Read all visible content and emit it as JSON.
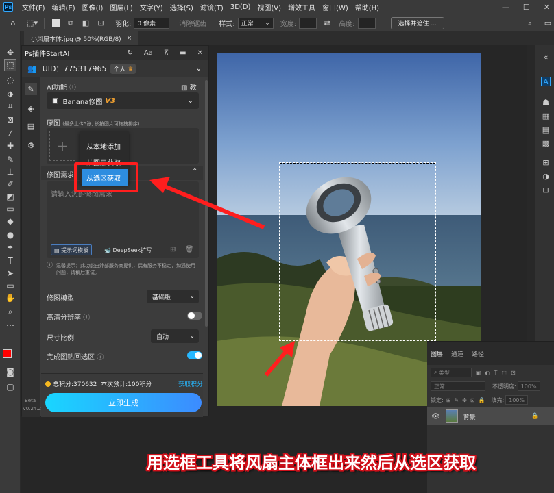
{
  "menu": [
    "文件(F)",
    "编辑(E)",
    "图像(I)",
    "图层(L)",
    "文字(Y)",
    "选择(S)",
    "滤镜(T)",
    "3D(D)",
    "视图(V)",
    "增效工具",
    "窗口(W)",
    "帮助(H)"
  ],
  "window_controls": [
    "—",
    "☐",
    "✕"
  ],
  "options": {
    "feather_label": "羽化:",
    "feather_value": "0 像素",
    "antialias_label": "消除锯齿",
    "style_label": "样式:",
    "style_value": "正常",
    "width_label": "宽度:",
    "height_label": "高度:",
    "select_mask_button": "选择并遮住 ..."
  },
  "document_tab": {
    "title": "小风扇本体.jpg @ 50%(RGB/8)",
    "close": "×"
  },
  "plugin": {
    "title": "Ps插件StartAI",
    "uid_label": "UID：775317965",
    "plan_badge": "个人",
    "ai_function_label": "AI功能",
    "tutorial_label": "教程",
    "model_select": "Banana修图",
    "model_version": "V3",
    "source_image_label": "原图",
    "source_image_hint": "(最多上传5张, 长按图片可拖拽排序)",
    "retouch_label": "修图需求",
    "retouch_placeholder": "请输入您的修图需求",
    "prompt_template_button": "提示词模板",
    "deepseek_button": "DeepSeek扩写",
    "warm_tip": "温馨提示：此功能由外部服务商提供，偶有服务不稳定，如遇使用问题，请稍后重试。",
    "model_label": "修图模型",
    "model_value": "基础版",
    "hd_label": "高清分辨率",
    "hd_enabled": false,
    "ratio_label": "尺寸比例",
    "ratio_value": "自动",
    "paste_back_label": "完成图贴回选区",
    "paste_back_enabled": true,
    "points_text": "总积分:370632",
    "estimate_text": "本次预计:100积分",
    "get_points_link": "获取积分",
    "generate_button": "立即生成",
    "beta_label": "Beta",
    "version_label": "V0.24.2"
  },
  "popup": {
    "items": [
      "从本地添加",
      "从图层获取",
      "从选区获取"
    ],
    "highlighted_index": 2
  },
  "layers_panel": {
    "tabs": [
      "图层",
      "通道",
      "路径"
    ],
    "kind_label": "类型",
    "blend_mode": "正常",
    "opacity_label": "不透明度:",
    "opacity_value": "100%",
    "lock_label": "锁定:",
    "fill_label": "填充:",
    "fill_value": "100%",
    "layer_name": "背景"
  },
  "caption": "用选框工具将风扇主体框出来然后从选区获取",
  "colors": {
    "accent_blue": "#27b8ff",
    "annotation_red": "#ff1e1e",
    "foreground_swatch": "#ff0000",
    "background_swatch": "#ffffff"
  }
}
